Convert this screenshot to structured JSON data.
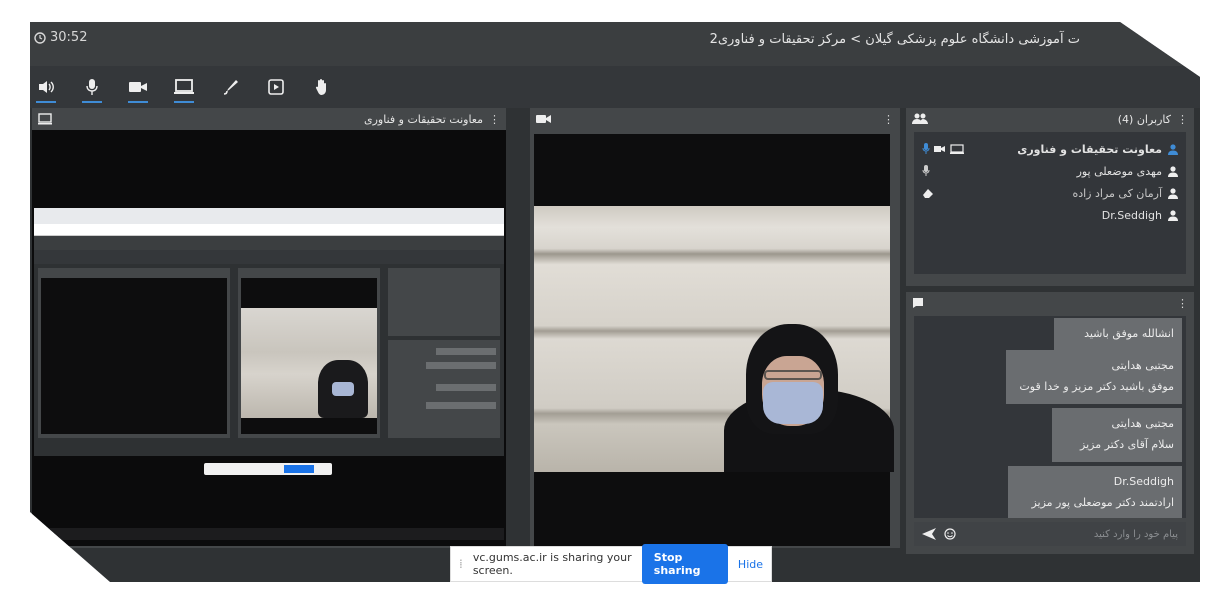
{
  "window": {
    "timer": "30:52",
    "title": "ت آموزشی دانشگاه علوم پزشکی گیلان > مرکز تحقیقات و فناوری2"
  },
  "toolbar": {
    "items": [
      "speaker-icon",
      "microphone-icon",
      "camera-icon",
      "screen-share-icon",
      "brush-icon",
      "presentation-icon",
      "raise-hand-icon"
    ]
  },
  "share_panel": {
    "title": "معاونت تحقیقات و فناوری"
  },
  "participants": {
    "title": "کاربران (4)",
    "users": [
      {
        "name": "معاونت تحقیقات و فناوری"
      },
      {
        "name": "مهدی موضعلی پور"
      },
      {
        "name": "آرمان کی مراد زاده"
      },
      {
        "name": "Dr.Seddigh"
      }
    ]
  },
  "chat": {
    "messages": [
      {
        "sender": "",
        "text": "انشالله موفق باشید"
      },
      {
        "sender": "مجتبی هدایتی",
        "text": "موفق باشید دکتر مزیز و خدا قوت"
      },
      {
        "sender": "مجتبی هدایتی",
        "text": "سلام آقای دکتر مزیز"
      },
      {
        "sender": "Dr.Seddigh",
        "text": "ارادتمند دکتر موضعلی پور مزیز"
      }
    ],
    "input_placeholder": "پیام خود را وارد کنید"
  },
  "sharing_bar": {
    "message": "vc.gums.ac.ir is sharing your screen.",
    "stop_label": "Stop sharing",
    "hide_label": "Hide"
  },
  "colors": {
    "accent": "#3f8cd6",
    "stop_button": "#1a73e8",
    "background": "#2f3234",
    "panel": "#444749"
  }
}
